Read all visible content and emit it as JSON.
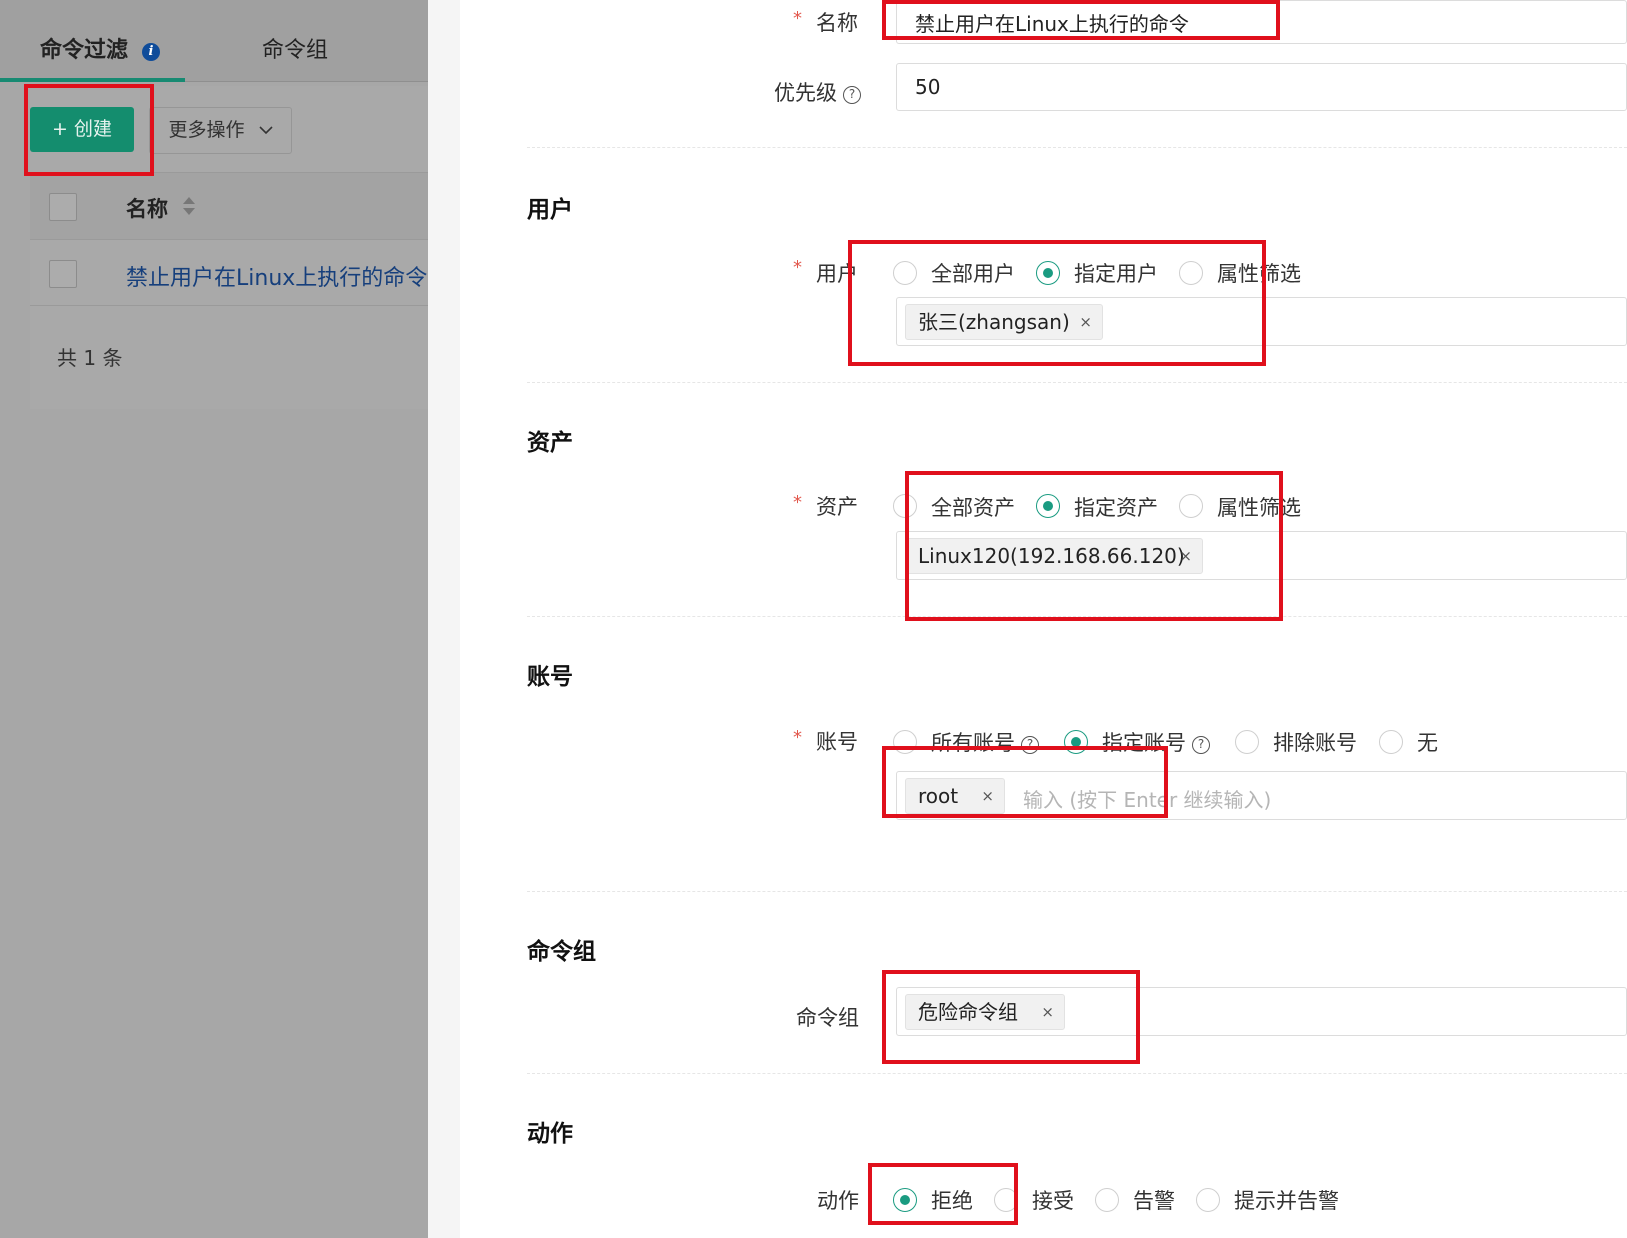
{
  "left_panel": {
    "tabs": [
      {
        "label": "命令过滤",
        "info_icon": "i"
      },
      {
        "label": "命令组"
      }
    ],
    "create_button": "+ 创建",
    "more_button": "更多操作",
    "table": {
      "header": "名称",
      "rows": [
        "禁止用户在Linux上执行的命令"
      ]
    },
    "total": "共 1 条"
  },
  "form": {
    "name": {
      "label": "名称",
      "required": "*",
      "value": "禁止用户在Linux上执行的命令"
    },
    "priority": {
      "label": "优先级",
      "help": "?",
      "value": "50"
    },
    "user_section": {
      "title": "用户",
      "label": "用户",
      "required": "*",
      "options": [
        "全部用户",
        "指定用户",
        "属性筛选"
      ],
      "selected": "指定用户",
      "tags": [
        "张三(zhangsan)"
      ]
    },
    "asset_section": {
      "title": "资产",
      "label": "资产",
      "required": "*",
      "options": [
        "全部资产",
        "指定资产",
        "属性筛选"
      ],
      "selected": "指定资产",
      "tags": [
        "Linux120(192.168.66.120)"
      ]
    },
    "account_section": {
      "title": "账号",
      "label": "账号",
      "required": "*",
      "options": [
        "所有账号",
        "指定账号",
        "排除账号",
        "无"
      ],
      "selected": "指定账号",
      "tags": [
        "root"
      ],
      "placeholder": "输入 (按下 Enter 继续输入)"
    },
    "command_group_section": {
      "title": "命令组",
      "label": "命令组",
      "tags": [
        "危险命令组"
      ]
    },
    "action_section": {
      "title": "动作",
      "label": "动作",
      "options": [
        "拒绝",
        "接受",
        "告警",
        "提示并告警"
      ],
      "selected": "拒绝"
    },
    "tag_close": "×"
  },
  "colors": {
    "accent": "#1a9b81",
    "highlight": "#e0101c",
    "link": "#163f7c",
    "required": "#e2574c"
  }
}
